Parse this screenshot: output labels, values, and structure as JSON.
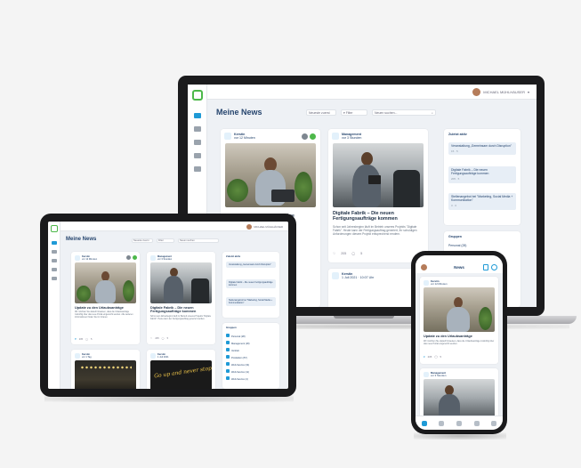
{
  "laptop": {
    "page_title": "Meine News",
    "user_name": "MICHAEL MÜHLHÄUSER",
    "filters": [
      "Neueste zuerst",
      "Filter",
      "Neuen suchen..."
    ],
    "cards": [
      {
        "author": "Kerstin",
        "author_meta": "vor 12 Minuten",
        "title": "Update zu den Urlaubsanträge",
        "body": "Wir möchten Sie darauf hinweisen, dass",
        "image": "woman-laptop"
      },
      {
        "author": "Management",
        "author_meta": "vor 3 Stunden",
        "title": "Digitale Fabrik – Die neuen Fertigungsaufträge kommen",
        "body": "Schon seit Jahresbeginn läuft im Betrieb unseres Projekts \"Digitale Fabrik\". Heute kann der Fertigungsauftrag generiert, Ihr schuldigen Anforderungen diesem Projekt entsprechend rendern.",
        "likes": "205",
        "comments": "5",
        "image": "man-tablet"
      },
      {
        "author": "Kerstin",
        "author_meta": "1 Juli 2021 · 10:07 Uhr"
      }
    ],
    "sidebar": {
      "title": "Zuletzt aktiv",
      "items": [
        {
          "text": "Veranstaltung „Gemeinsam durch Disruption\"",
          "meta": "15 · 5"
        },
        {
          "text": "Digitale Fabrik – Die neuen Fertigungsaufträge kommen",
          "meta": "205 · 5"
        },
        {
          "text": "Stellenangebot bei \"Marketing, Social Media + Kommunikation\"",
          "meta": "3 · 0"
        }
      ],
      "groups_title": "Gruppen",
      "group_first": "Personal (28)"
    }
  },
  "tablet": {
    "page_title": "Meine News",
    "user_name": "MICHAEL MÜHLHÄUSER",
    "filters": [
      "Neueste zuerst",
      "Filter",
      "Neuen suchen"
    ],
    "cards": [
      {
        "author": "Kerstin",
        "author_meta": "vor 12 Minuten",
        "title": "Update zu den Urlaubsanträge",
        "body": "Wir möchten Sie darauf hinweisen, dass die Urlaubsanträge zukünftig über das neue Portal eingereicht werden. Alle weiteren Informationen finden Sie im Intranet.",
        "likes": "205",
        "comments": "5"
      },
      {
        "author": "Management",
        "author_meta": "vor 3 Stunden",
        "title": "Digitale Fabrik – Die neuen Fertigungsaufträge kommen",
        "body": "Schon seit Jahresbeginn läuft im Betrieb unseres Projekts \"Digitale Fabrik\". Heute kann der Fertigungsauftrag generiert werden.",
        "likes": "205",
        "comments": "5"
      },
      {
        "author": "Kerstin",
        "author_meta": "vor 1 Tag"
      },
      {
        "author": "Kerstin",
        "author_meta": "1 Juli 2021"
      }
    ],
    "chalk_text": "Go up and never stop",
    "sidebar": {
      "title": "Zuletzt aktiv",
      "items": [
        {
          "text": "Veranstaltung „Gemeinsam durch Disruption\""
        },
        {
          "text": "Digitale Fabrik – Die neuen Fertigungsaufträge kommen"
        },
        {
          "text": "Stellenangebot bei \"Marketing, Social Media + Kommunikation\""
        }
      ],
      "groups_title": "Gruppen",
      "groups": [
        "Personal (28)",
        "Management (18)",
        "Vertrieb",
        "Produktion (57)",
        "Web-Service (34)",
        "Web-Service (11)",
        "Web-Service (4)"
      ]
    }
  },
  "phone": {
    "page_title": "News",
    "cards": [
      {
        "author": "Kerstin",
        "author_meta": "vor 12 Minuten",
        "title": "Update zu den Urlaubsanträge",
        "body": "Wir möchten Sie darauf hinweisen, dass die Urlaubsanträge zukünftig über das neue Portal eingereicht werden.",
        "likes": "205",
        "comments": "5"
      },
      {
        "author": "Management",
        "author_meta": "vor 3 Stunden"
      }
    ]
  },
  "colors": {
    "brand_green": "#4db84a",
    "brand_blue": "#1f9ad6",
    "title_navy": "#26456e"
  },
  "icons": [
    "logo-icon",
    "news-icon",
    "tasks-icon",
    "documents-icon",
    "chat-icon",
    "calendar-icon",
    "filter-icon",
    "search-icon",
    "heart-icon",
    "comment-icon",
    "bookmark-icon",
    "more-icon"
  ]
}
